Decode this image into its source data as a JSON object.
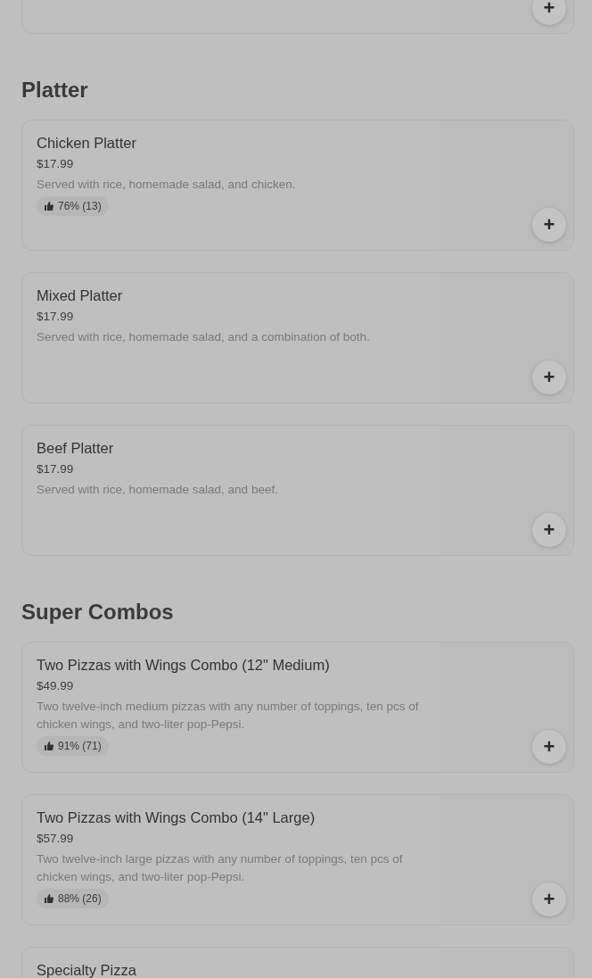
{
  "top_card": {
    "add_button": "+"
  },
  "sections": [
    {
      "title": "Platter",
      "items": [
        {
          "name": "Chicken Platter",
          "price": "$17.99",
          "description": "Served with rice, homemade salad, and chicken.",
          "rating": "76% (13)",
          "add_button": "+"
        },
        {
          "name": "Mixed Platter",
          "price": "$17.99",
          "description": "Served with rice, homemade salad, and a combination of both.",
          "add_button": "+"
        },
        {
          "name": "Beef Platter",
          "price": "$17.99",
          "description": "Served with rice, homemade salad, and beef.",
          "add_button": "+"
        }
      ]
    },
    {
      "title": "Super Combos",
      "items": [
        {
          "name": "Two Pizzas with Wings Combo (12\" Medium)",
          "price": "$49.99",
          "description": "Two twelve-inch medium pizzas with any number of toppings, ten pcs of chicken wings, and two-liter pop-Pepsi.",
          "rating": "91% (71)",
          "add_button": "+"
        },
        {
          "name": "Two Pizzas with Wings Combo (14\" Large)",
          "price": "$57.99",
          "description": "Two twelve-inch large pizzas with any number of toppings, ten pcs of chicken wings, and two-liter pop-Pepsi.",
          "rating": "88% (26)",
          "add_button": "+"
        },
        {
          "name": "Specialty Pizza"
        }
      ]
    }
  ]
}
